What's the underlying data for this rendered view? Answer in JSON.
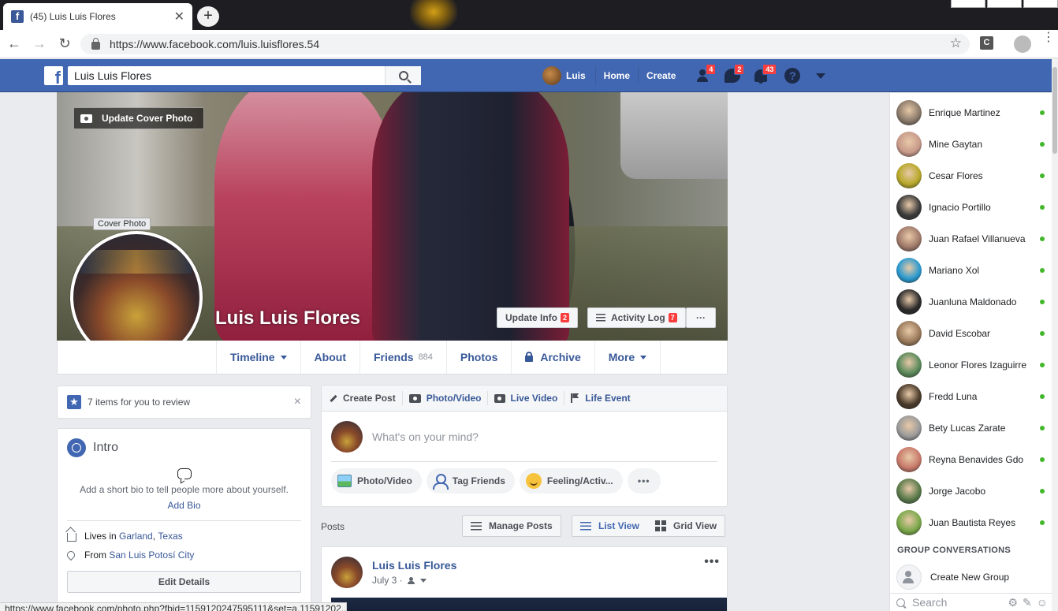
{
  "browser": {
    "tab_title": "(45) Luis Luis Flores",
    "url": "https://www.facebook.com/luis.luisflores.54",
    "extension_label": "C",
    "status_url": "https://www.facebook.com/photo.php?fbid=1159120247595111&set=a.11591202..."
  },
  "fb": {
    "search_value": "Luis Luis Flores",
    "nav": {
      "me": "Luis",
      "home": "Home",
      "create": "Create",
      "friend_requests": "4",
      "messages": "2",
      "notifications": "43"
    }
  },
  "cover": {
    "update_cover": "Update Cover Photo",
    "tooltip": "Cover Photo",
    "name": "Luis Luis Flores",
    "update_info": "Update Info",
    "update_info_count": "2",
    "activity_log": "Activity Log",
    "activity_log_count": "7",
    "more": "···"
  },
  "timeline_nav": {
    "timeline": "Timeline",
    "about": "About",
    "friends": "Friends",
    "friends_count": "884",
    "photos": "Photos",
    "archive": "Archive",
    "more": "More"
  },
  "review": {
    "text": "7 items for you to review",
    "close": "×"
  },
  "intro": {
    "title": "Intro",
    "bio_prompt": "Add a short bio to tell people more about yourself.",
    "add_bio": "Add Bio",
    "lives_prefix": "Lives in",
    "lives_city": "Garland",
    "lives_sep": ",",
    "lives_state": "Texas",
    "from_prefix": "From",
    "from_city": "San Luis Potosí City",
    "edit_details": "Edit Details"
  },
  "composer": {
    "create_post": "Create Post",
    "photo_video_tab": "Photo/Video",
    "live_video": "Live Video",
    "life_event": "Life Event",
    "placeholder": "What's on your mind?",
    "photo_video": "Photo/Video",
    "tag_friends": "Tag Friends",
    "feeling": "Feeling/Activ...",
    "more": "•••"
  },
  "posts_bar": {
    "label": "Posts",
    "manage": "Manage Posts",
    "list_view": "List View",
    "grid_view": "Grid View"
  },
  "post": {
    "author": "Luis Luis Flores",
    "date": "July 3 ·",
    "more": "•••"
  },
  "chat": {
    "contacts": [
      {
        "name": "Enrique Martinez",
        "color": "#8a7a6a"
      },
      {
        "name": "Mine Gaytan",
        "color": "#c89a8a"
      },
      {
        "name": "Cesar Flores",
        "color": "#b8a82a"
      },
      {
        "name": "Ignacio Portillo",
        "color": "#3a3a3a"
      },
      {
        "name": "Juan Rafael Villanueva",
        "color": "#a07a6a"
      },
      {
        "name": "Mariano Xol",
        "color": "#2a9ad0"
      },
      {
        "name": "Juanluna Maldonado",
        "color": "#2a2a2a"
      },
      {
        "name": "David Escobar",
        "color": "#9a7a5a"
      },
      {
        "name": "Leonor Flores Izaguirre",
        "color": "#5a8a5a"
      },
      {
        "name": "Fredd Luna",
        "color": "#4a3a2a"
      },
      {
        "name": "Bety Lucas Zarate",
        "color": "#9a9a9a"
      },
      {
        "name": "Reyna Benavides Gdo",
        "color": "#c87a6a"
      },
      {
        "name": "Jorge Jacobo",
        "color": "#5a7a4a"
      },
      {
        "name": "Juan Bautista Reyes",
        "color": "#7aa84a"
      }
    ],
    "group_header": "GROUP CONVERSATIONS",
    "create_group": "Create New Group",
    "search_placeholder": "Search"
  }
}
